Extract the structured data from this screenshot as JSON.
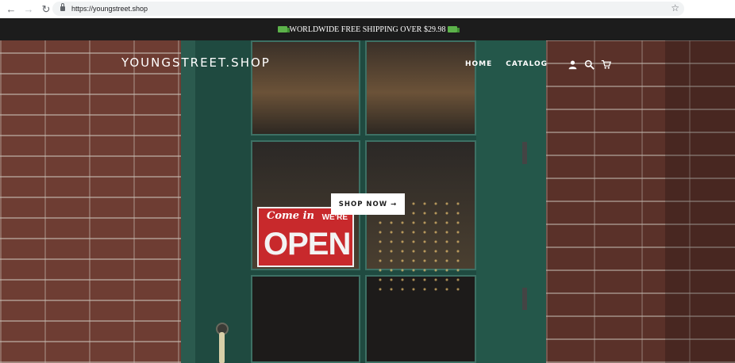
{
  "browser": {
    "url": "https://youngstreet.shop",
    "back_icon": "←",
    "forward_icon": "→",
    "reload_icon": "↻",
    "star_icon": "☆"
  },
  "announcement": {
    "text": "WORLDWIDE FREE SHIPPING OVER $29.98"
  },
  "header": {
    "logo": "YOUNGSTREET.SHOP",
    "nav": [
      "HOME",
      "CATALOG"
    ],
    "icons": [
      "user-icon",
      "search-icon",
      "cart-icon"
    ]
  },
  "hero": {
    "cta_label": "SHOP NOW →",
    "sign": {
      "top": "Come in",
      "right": "WE'RE",
      "main": "OPEN"
    }
  },
  "colors": {
    "announcement_bg": "#1c1c1c",
    "button_bg": "#ffffff",
    "sign_red": "#c8292c",
    "door_green": "#1f4a40"
  }
}
